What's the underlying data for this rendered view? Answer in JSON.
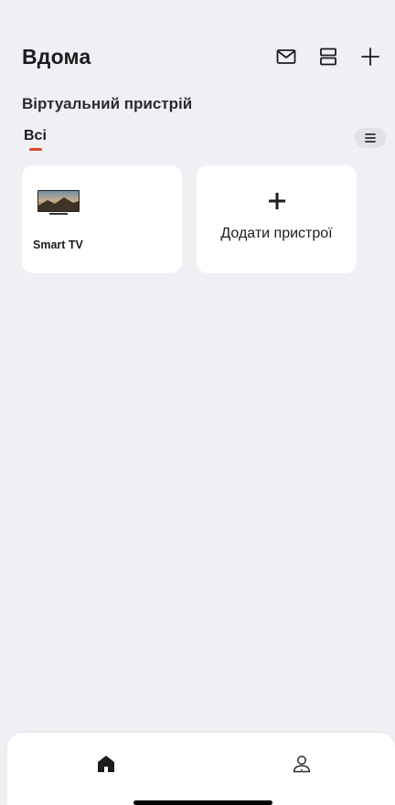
{
  "header": {
    "title": "Вдома",
    "icons": [
      "mail-icon",
      "layout-icon",
      "plus-icon"
    ]
  },
  "group": {
    "title": "Віртуальний пристрій"
  },
  "tabs": {
    "active_label": "Всі",
    "accent_color": "#e0452d"
  },
  "devices": [
    {
      "name": "Smart TV",
      "icon": "tv-thumbnail"
    }
  ],
  "add_device": {
    "label": "Додати пристрої",
    "icon": "plus-icon"
  },
  "bottom_nav": {
    "items": [
      {
        "icon": "home-icon",
        "active": true
      },
      {
        "icon": "profile-icon",
        "active": false
      }
    ]
  }
}
